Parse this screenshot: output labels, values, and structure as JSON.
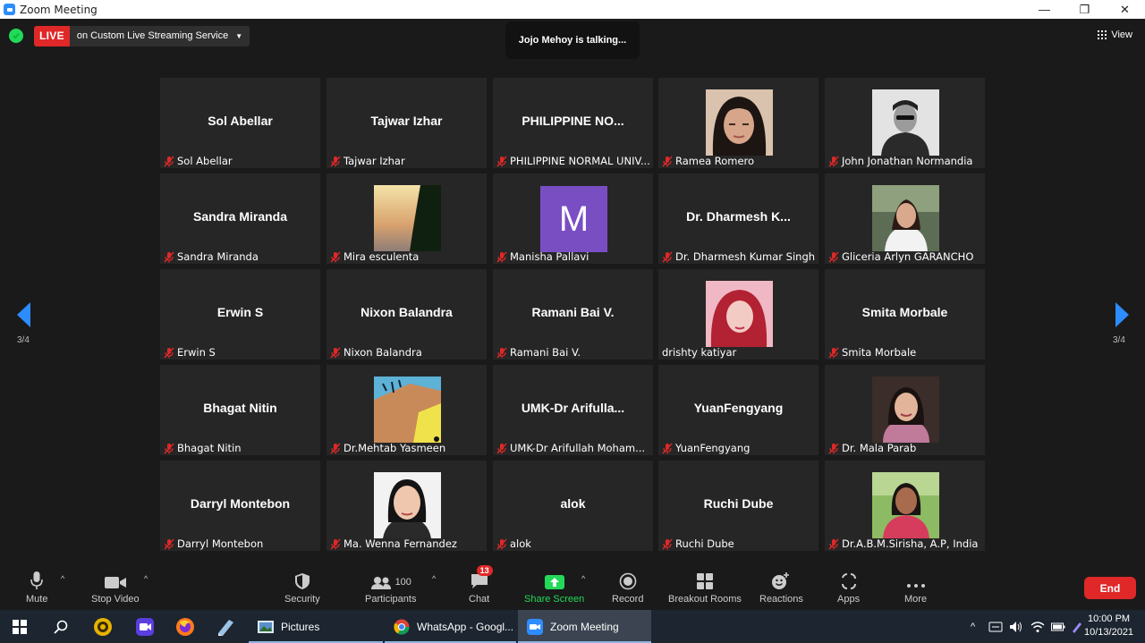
{
  "window": {
    "title": "Zoom Meeting",
    "minimize": "—",
    "restore": "❐",
    "close": "✕"
  },
  "topbar": {
    "live_label": "LIVE",
    "stream_service": "on Custom Live Streaming Service",
    "talking": "Jojo Mehoy is talking...",
    "view_label": "View"
  },
  "pagination": {
    "left": "3/4",
    "right": "3/4"
  },
  "tiles": [
    {
      "name": "Sol Abellar",
      "label": "Sol Abellar",
      "muted": true
    },
    {
      "name": "Tajwar Izhar",
      "label": "Tajwar Izhar",
      "muted": true
    },
    {
      "name": "PHILIPPINE  NO...",
      "label": "PHILIPPINE NORMAL UNIV...",
      "muted": true
    },
    {
      "name": "",
      "label": "Ramea Romero",
      "muted": true,
      "photo": "ramea"
    },
    {
      "name": "",
      "label": "John Jonathan Normandia",
      "muted": true,
      "photo": "john"
    },
    {
      "name": "Sandra Miranda",
      "label": "Sandra Miranda",
      "muted": true
    },
    {
      "name": "",
      "label": "Mira esculenta",
      "muted": true,
      "photo": "mira"
    },
    {
      "name": "M",
      "label": "Manisha Pallavi",
      "muted": true,
      "initial": true
    },
    {
      "name": "Dr.  Dharmesh  K...",
      "label": "Dr. Dharmesh Kumar Singh",
      "muted": true
    },
    {
      "name": "",
      "label": "Gliceria Arlyn GARANCHO",
      "muted": true,
      "photo": "gliceria"
    },
    {
      "name": "Erwin S",
      "label": "Erwin S",
      "muted": true
    },
    {
      "name": "Nixon Balandra",
      "label": "Nixon Balandra",
      "muted": true
    },
    {
      "name": "Ramani Bai V.",
      "label": "Ramani Bai V.",
      "muted": true
    },
    {
      "name": "",
      "label": "drishty katiyar",
      "muted": false,
      "photo": "drishty"
    },
    {
      "name": "Smita Morbale",
      "label": "Smita Morbale",
      "muted": true
    },
    {
      "name": "Bhagat Nitin",
      "label": "Bhagat Nitin",
      "muted": true
    },
    {
      "name": "",
      "label": "Dr.Mehtab Yasmeen",
      "muted": true,
      "photo": "mehtab"
    },
    {
      "name": "UMK-Dr  Arifulla...",
      "label": "UMK-Dr Arifullah Moham...",
      "muted": true
    },
    {
      "name": "YuanFengyang",
      "label": "YuanFengyang",
      "muted": true
    },
    {
      "name": "",
      "label": "Dr. Mala Parab",
      "muted": true,
      "photo": "mala"
    },
    {
      "name": "Darryl Montebon",
      "label": "Darryl Montebon",
      "muted": true
    },
    {
      "name": "",
      "label": "Ma. Wenna Fernandez",
      "muted": true,
      "photo": "wenna"
    },
    {
      "name": "alok",
      "label": "alok",
      "muted": true
    },
    {
      "name": "Ruchi Dube",
      "label": "Ruchi Dube",
      "muted": true
    },
    {
      "name": "",
      "label": "Dr.A.B.M.Sirisha, A.P, India",
      "muted": true,
      "photo": "sirisha"
    }
  ],
  "toolbar": {
    "mute": "Mute",
    "stop_video": "Stop Video",
    "security": "Security",
    "participants": "Participants",
    "participants_count": "100",
    "chat": "Chat",
    "chat_badge": "13",
    "share_screen": "Share Screen",
    "record": "Record",
    "breakout": "Breakout Rooms",
    "reactions": "Reactions",
    "apps": "Apps",
    "more": "More",
    "end": "End"
  },
  "taskbar": {
    "pictures": "Pictures",
    "whatsapp": "WhatsApp - Googl...",
    "zoom": "Zoom Meeting",
    "time": "10:00 PM",
    "date": "10/13/2021"
  },
  "colors": {
    "live": "#e02828",
    "share": "#23d959",
    "zoom": "#2d8cff",
    "tile": "#262626"
  }
}
